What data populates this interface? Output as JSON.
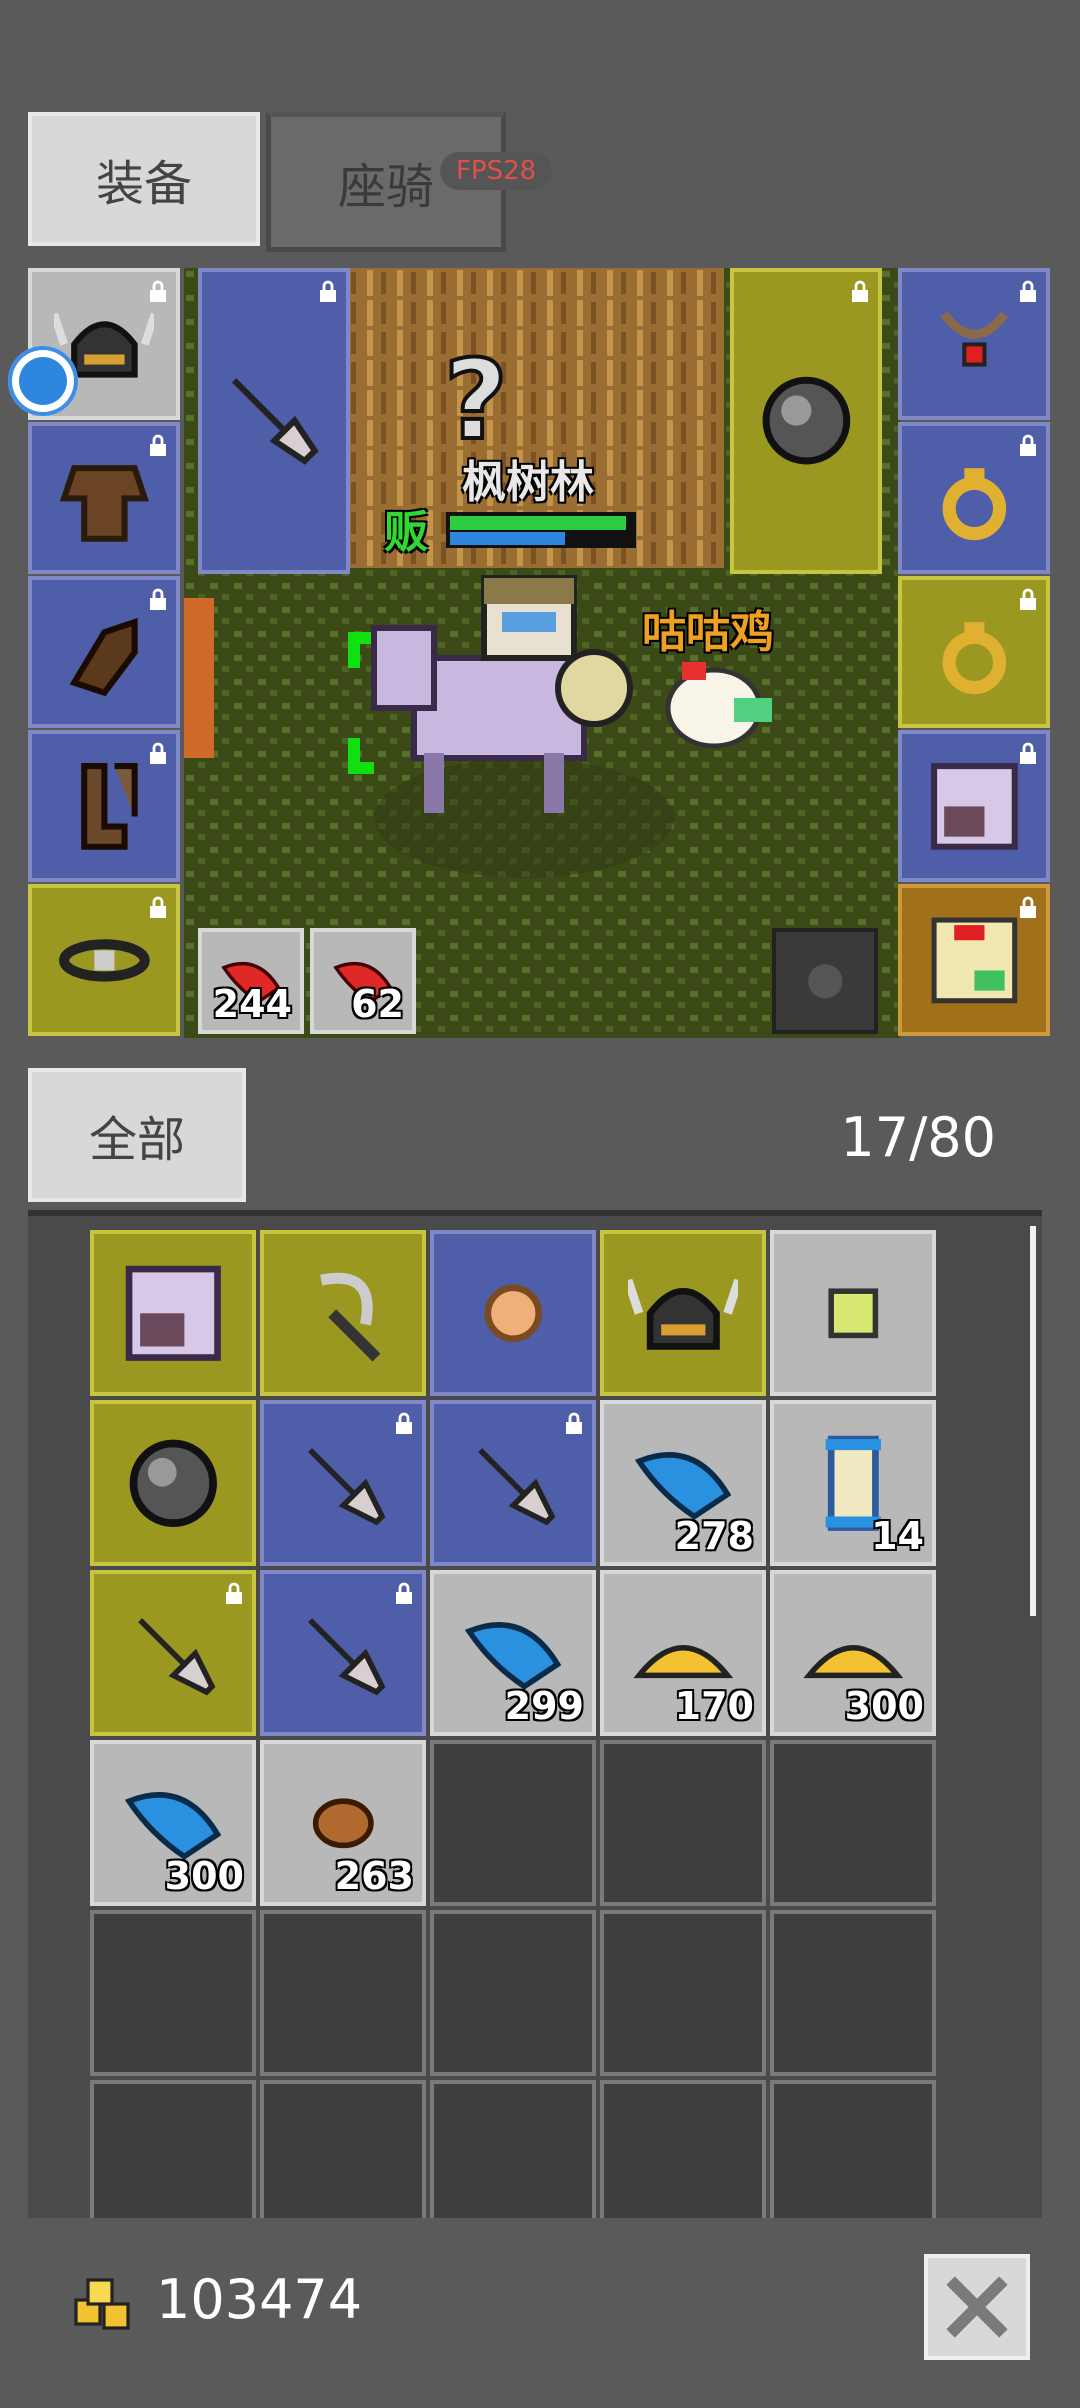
{
  "tabs": {
    "equip": "装备",
    "mount": "座骑",
    "fps": "FPS28"
  },
  "scene": {
    "location_name": "枫树林",
    "npc_partial": "贩",
    "pet_name": "咕咕鸡",
    "hp_fraction": 0.95,
    "mp_fraction": 0.62
  },
  "quickbar": [
    {
      "icon": "red-feather-icon",
      "count": "244"
    },
    {
      "icon": "red-feather-icon",
      "count": "62"
    }
  ],
  "equip_left": [
    {
      "icon": "viking-helmet-icon",
      "color": "gray",
      "locked": true
    },
    {
      "icon": "leather-armor-icon",
      "color": "blue",
      "locked": true
    },
    {
      "icon": "leather-glove-icon",
      "color": "blue",
      "locked": true
    },
    {
      "icon": "leather-boots-icon",
      "color": "blue",
      "locked": true
    },
    {
      "icon": "belt-icon",
      "color": "yellow",
      "locked": true
    }
  ],
  "equip_right": [
    {
      "icon": "ruby-necklace-icon",
      "color": "blue",
      "locked": true
    },
    {
      "icon": "gold-ring-icon",
      "color": "blue",
      "locked": true
    },
    {
      "icon": "gold-ring-icon",
      "color": "yellow",
      "locked": true
    },
    {
      "icon": "horse-portrait-icon",
      "color": "blue",
      "locked": true
    },
    {
      "icon": "chicken-portrait-icon",
      "color": "orange",
      "locked": true
    }
  ],
  "filter": {
    "label": "全部",
    "capacity": "17/80"
  },
  "inventory": [
    {
      "icon": "horse-portrait-icon",
      "color": "yellow",
      "locked": false,
      "count": ""
    },
    {
      "icon": "sickle-icon",
      "color": "yellow",
      "locked": false,
      "count": ""
    },
    {
      "icon": "bread-icon",
      "color": "blue",
      "locked": false,
      "count": ""
    },
    {
      "icon": "viking-helmet-icon",
      "color": "yellow",
      "locked": false,
      "count": ""
    },
    {
      "icon": "green-cube-icon",
      "color": "gray",
      "locked": false,
      "count": ""
    },
    {
      "icon": "round-shield-icon",
      "color": "yellow",
      "locked": false,
      "count": ""
    },
    {
      "icon": "dagger-icon",
      "color": "blue",
      "locked": true,
      "count": ""
    },
    {
      "icon": "dagger-icon",
      "color": "blue",
      "locked": true,
      "count": ""
    },
    {
      "icon": "blue-feather-icon",
      "color": "gray",
      "locked": false,
      "count": "278"
    },
    {
      "icon": "scroll-icon",
      "color": "gray",
      "locked": false,
      "count": "14"
    },
    {
      "icon": "dagger-icon",
      "color": "yellow",
      "locked": true,
      "count": ""
    },
    {
      "icon": "dagger-icon",
      "color": "blue",
      "locked": true,
      "count": ""
    },
    {
      "icon": "blue-feather-icon",
      "color": "gray",
      "locked": false,
      "count": "299"
    },
    {
      "icon": "gold-pile-icon",
      "color": "gray",
      "locked": false,
      "count": "170"
    },
    {
      "icon": "gold-pile-icon",
      "color": "gray",
      "locked": false,
      "count": "300"
    },
    {
      "icon": "blue-feather-icon",
      "color": "gray",
      "locked": false,
      "count": "300"
    },
    {
      "icon": "meat-icon",
      "color": "gray",
      "locked": false,
      "count": "263"
    }
  ],
  "gold": {
    "icon": "gold-coins-icon",
    "amount": "103474"
  },
  "close": {
    "icon": "close-icon"
  },
  "colors": {
    "blue_slot": "#4f5ea8",
    "yellow_slot": "#9a9820",
    "orange_slot": "#a0701a",
    "gray_slot": "#b8b8b8",
    "hp": "#2ecc40",
    "mp": "#2e86de"
  }
}
